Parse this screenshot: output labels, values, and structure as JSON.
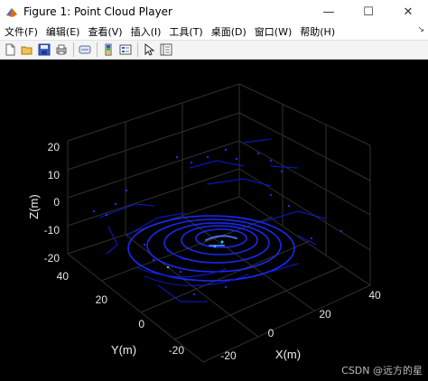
{
  "window": {
    "title": "Figure 1: Point Cloud Player",
    "minimize_glyph": "—",
    "maximize_glyph": "☐",
    "close_glyph": "✕"
  },
  "menu": {
    "items": [
      "文件(F)",
      "编辑(E)",
      "查看(V)",
      "插入(I)",
      "工具(T)",
      "桌面(D)",
      "窗口(W)",
      "帮助(H)"
    ],
    "overflow_glyph": "↘"
  },
  "toolbar": {
    "buttons": [
      "new-figure-icon",
      "open-file-icon",
      "save-icon",
      "print-icon",
      "link-plot-icon",
      "colorbar-icon",
      "legend-icon",
      "pointer-icon",
      "property-inspector-icon"
    ]
  },
  "plot": {
    "background": "#000000",
    "point_color": "#1a2cff",
    "axes": {
      "x": {
        "label": "X(m)",
        "ticks": [
          "-20",
          "0",
          "20",
          "40"
        ]
      },
      "y": {
        "label": "Y(m)",
        "ticks": [
          "-20",
          "0",
          "20",
          "40"
        ]
      },
      "z": {
        "label": "Z(m)",
        "ticks": [
          "20",
          "10",
          "0",
          "-10",
          "-20"
        ]
      }
    }
  },
  "watermark": "CSDN @远方的星"
}
